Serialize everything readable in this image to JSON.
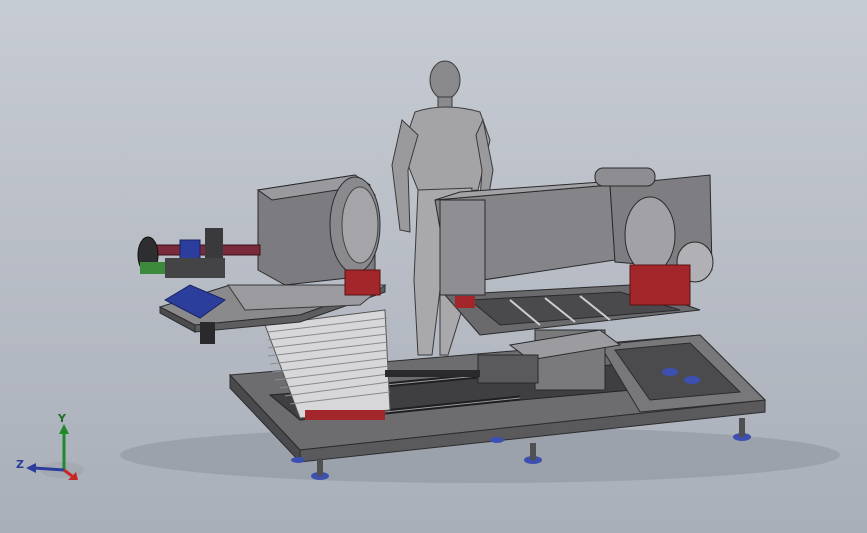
{
  "triad": {
    "x_label": "",
    "y_label": "Y",
    "z_label": "Z"
  },
  "colors": {
    "background_top": "#c7ccd4",
    "background_bottom": "#a9afb9",
    "machine_grey": "#7a7a7c",
    "machine_dark": "#3e3e40",
    "red_mount": "#a3262a",
    "blue_part": "#2b3e9c",
    "feet_blue": "#3d4fb0"
  }
}
